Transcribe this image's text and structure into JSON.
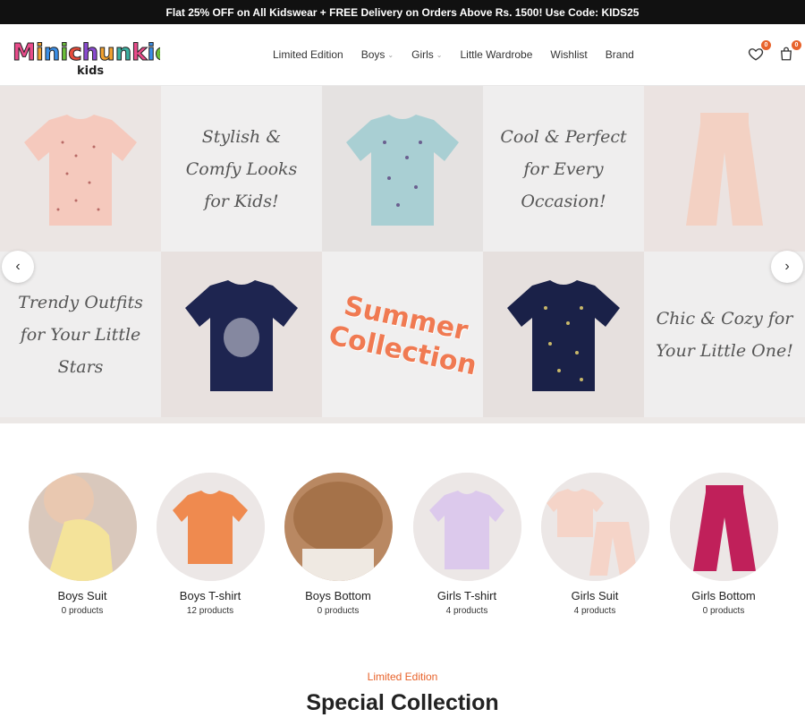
{
  "announcement": "Flat 25% OFF on All Kidswear + FREE Delivery on Orders Above Rs. 1500! Use Code: KIDS25",
  "logo": {
    "main": "Minichunkies",
    "sub": "kids"
  },
  "nav": [
    {
      "label": "Limited Edition"
    },
    {
      "label": "Boys"
    },
    {
      "label": "Girls"
    },
    {
      "label": "Little Wardrobe"
    },
    {
      "label": "Wishlist"
    },
    {
      "label": "Brand"
    }
  ],
  "wishlist_count": "0",
  "cart_count": "0",
  "hero": {
    "text1": "Stylish & Comfy Looks for Kids!",
    "text2": "Cool & Perfect for Every Occasion!",
    "text3": "Trendy Outfits for Your Little Stars",
    "text4": "Summer Collection",
    "text5": "Chic & Cozy for Your Little One!"
  },
  "categories": [
    {
      "name": "Boys Suit",
      "count": "0 products"
    },
    {
      "name": "Boys T-shirt",
      "count": "12 products"
    },
    {
      "name": "Boys Bottom",
      "count": "0 products"
    },
    {
      "name": "Girls T-shirt",
      "count": "4 products"
    },
    {
      "name": "Girls Suit",
      "count": "4 products"
    },
    {
      "name": "Girls Bottom",
      "count": "0 products"
    }
  ],
  "section": {
    "subtitle": "Limited Edition",
    "title": "Special Collection"
  },
  "colors": {
    "accent": "#e8632b",
    "topbar": "#111111",
    "tile_bg": "#ece8e6",
    "summer": "#f07a52"
  }
}
